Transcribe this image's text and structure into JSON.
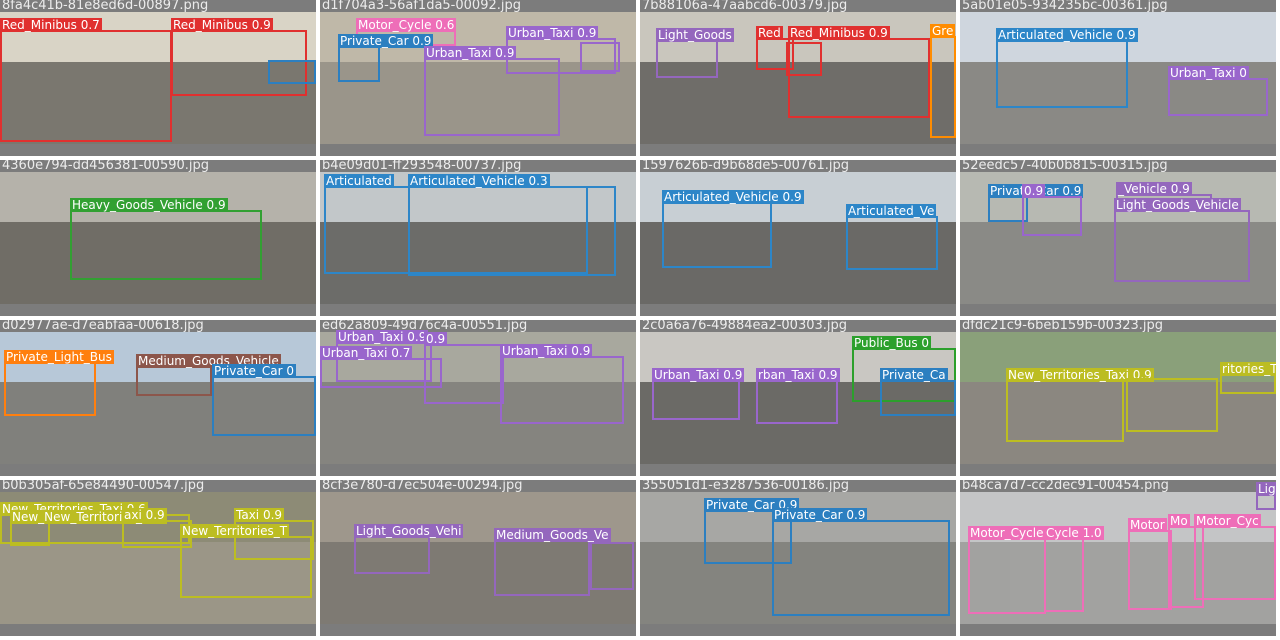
{
  "palette": {
    "Red_Minibus": "#e0302f",
    "Motor_Cycle": "#ee6eb8",
    "Private_Car": "#2c7fc0",
    "Urban_Taxi": "#9966cc",
    "Light_Goods_Vehicle": "#9467bd",
    "Green_Minibus": "#ff8c00",
    "Articulated_Vehicle": "#2d86c8",
    "Heavy_Goods_Vehicle": "#32a032",
    "Private_Light_Bus": "#ff7f0e",
    "Medium_Goods_Vehicle": "#8c564b",
    "Public_Bus": "#2ca02c",
    "New_Territories_Taxi": "#bcbd22"
  },
  "tiles": [
    {
      "filename": "8fa4c41b-81e8ed6d-00897.png",
      "sky": "#d9d4c6",
      "ground": "#7a776f",
      "detections": [
        {
          "label": "Red_Minibus 0.7",
          "cls": "Red_Minibus"
        },
        {
          "label": "Red_Minibus 0.9",
          "cls": "Red_Minibus"
        },
        {
          "label": "",
          "cls": "Private_Car"
        }
      ]
    },
    {
      "filename": "d1f704a3-56af1da5-00092.jpg",
      "sky": "#bfb8a8",
      "ground": "#9a958a",
      "detections": [
        {
          "label": "Motor_Cycle 0.6",
          "cls": "Motor_Cycle"
        },
        {
          "label": "Private_Car 0.9",
          "cls": "Private_Car"
        },
        {
          "label": "Urban_Taxi 0.9",
          "cls": "Urban_Taxi"
        },
        {
          "label": "Urban_Taxi 0.9",
          "cls": "Urban_Taxi"
        },
        {
          "label": "",
          "cls": "Urban_Taxi"
        }
      ]
    },
    {
      "filename": "7b88106a-47aabcd6-00379.jpg",
      "sky": "#c9c6bd",
      "ground": "#6f6d69",
      "detections": [
        {
          "label": "Light_Goods",
          "cls": "Light_Goods_Vehicle"
        },
        {
          "label": "Red",
          "cls": "Red_Minibus"
        },
        {
          "label": "Red_Minibus 0.9",
          "cls": "Red_Minibus"
        },
        {
          "label": "",
          "cls": "Red_Minibus"
        },
        {
          "label": "Gre",
          "cls": "Green_Minibus"
        }
      ]
    },
    {
      "filename": "5ab01e05-934235bc-00361.jpg",
      "sky": "#cfd6de",
      "ground": "#8a8985",
      "detections": [
        {
          "label": "Articulated_Vehicle 0.9",
          "cls": "Articulated_Vehicle"
        },
        {
          "label": "Urban_Taxi 0",
          "cls": "Urban_Taxi"
        }
      ]
    },
    {
      "filename": "4360e794-dd456381-00590.jpg",
      "sky": "#b5b2aa",
      "ground": "#706d66",
      "detections": [
        {
          "label": "Heavy_Goods_Vehicle 0.9",
          "cls": "Heavy_Goods_Vehicle"
        }
      ]
    },
    {
      "filename": "b4e09d01-ff293548-00737.jpg",
      "sky": "#c2c7c9",
      "ground": "#6c6c69",
      "detections": [
        {
          "label": "Articulated",
          "cls": "Articulated_Vehicle"
        },
        {
          "label": "Articulated_Vehicle 0.3",
          "cls": "Articulated_Vehicle"
        }
      ]
    },
    {
      "filename": "1597626b-d9b68de5-00761.jpg",
      "sky": "#c8cfd4",
      "ground": "#6a6966",
      "detections": [
        {
          "label": "Articulated_Vehicle 0.9",
          "cls": "Articulated_Vehicle"
        },
        {
          "label": "Articulated_Ve",
          "cls": "Articulated_Vehicle"
        }
      ]
    },
    {
      "filename": "52eedc57-40b0b815-00315.jpg",
      "sky": "#b7b9b2",
      "ground": "#8a8a86",
      "detections": [
        {
          "label": "Private_Car 0.9",
          "cls": "Private_Car"
        },
        {
          "label": "0.9",
          "cls": "Urban_Taxi"
        },
        {
          "label": "_Vehicle 0.9",
          "cls": "Light_Goods_Vehicle"
        },
        {
          "label": "Light_Goods_Vehicle",
          "cls": "Light_Goods_Vehicle"
        }
      ]
    },
    {
      "filename": "d02977ae-d7eabfaa-00618.jpg",
      "sky": "#b7c8d8",
      "ground": "#80807c",
      "detections": [
        {
          "label": "Private_Light_Bus",
          "cls": "Private_Light_Bus"
        },
        {
          "label": "Medium_Goods_Vehicle",
          "cls": "Medium_Goods_Vehicle"
        },
        {
          "label": "Private_Car 0",
          "cls": "Private_Car"
        }
      ]
    },
    {
      "filename": "ed62a809-49d76c4a-00551.jpg",
      "sky": "#a8a89e",
      "ground": "#85847f",
      "detections": [
        {
          "label": "Urban_Taxi 0.9",
          "cls": "Urban_Taxi"
        },
        {
          "label": "Urban_Taxi 0.7",
          "cls": "Urban_Taxi"
        },
        {
          "label": "0.9",
          "cls": "Urban_Taxi"
        },
        {
          "label": "Urban_Taxi 0.9",
          "cls": "Urban_Taxi"
        }
      ]
    },
    {
      "filename": "2c0a6a76-49884ea2-00303.jpg",
      "sky": "#c9c7c2",
      "ground": "#6b6a66",
      "detections": [
        {
          "label": "Public_Bus 0",
          "cls": "Public_Bus"
        },
        {
          "label": "Urban_Taxi 0.9",
          "cls": "Urban_Taxi"
        },
        {
          "label": "rban_Taxi 0.9",
          "cls": "Urban_Taxi"
        },
        {
          "label": "Private_Ca",
          "cls": "Private_Car"
        }
      ]
    },
    {
      "filename": "dfdc21c9-6beb159b-00323.jpg",
      "sky": "#8aa07a",
      "ground": "#8b8780",
      "detections": [
        {
          "label": "New_Territories_Taxi 0.9",
          "cls": "New_Territories_Taxi"
        },
        {
          "label": "ritories_Tax",
          "cls": "New_Territories_Taxi"
        },
        {
          "label": "",
          "cls": "New_Territories_Taxi"
        }
      ]
    },
    {
      "filename": "b0b305af-65e84490-00547.jpg",
      "sky": "#8d8b76",
      "ground": "#9b9687",
      "detections": [
        {
          "label": "New_Territories_Taxi 0.6",
          "cls": "New_Territories_Taxi"
        },
        {
          "label": "New_New_Territories_Taxi",
          "cls": "New_Territories_Taxi"
        },
        {
          "label": "axi 0.9",
          "cls": "New_Territories_Taxi"
        },
        {
          "label": "Taxi 0.9",
          "cls": "New_Territories_Taxi"
        },
        {
          "label": "New_Territories_T",
          "cls": "New_Territories_Taxi"
        }
      ]
    },
    {
      "filename": "8cf3e780-d7ec504e-00294.jpg",
      "sky": "#9e978c",
      "ground": "#7e7a73",
      "detections": [
        {
          "label": "Light_Goods_Vehi",
          "cls": "Light_Goods_Vehicle"
        },
        {
          "label": "Medium_Goods_Ve",
          "cls": "Light_Goods_Vehicle"
        },
        {
          "label": "",
          "cls": "Light_Goods_Vehicle"
        }
      ]
    },
    {
      "filename": "355051d1-e3287536-00186.jpg",
      "sky": "#a7a7a4",
      "ground": "#84847f",
      "detections": [
        {
          "label": "Private_Car 0.9",
          "cls": "Private_Car"
        },
        {
          "label": "Private_Car 0.9",
          "cls": "Private_Car"
        }
      ]
    },
    {
      "filename": "b48ca7d7-cc2dec91-00454.png",
      "sky": "#c4c5c6",
      "ground": "#a2a2a0",
      "detections": [
        {
          "label": "Motor_Cycle 0.9",
          "cls": "Motor_Cycle"
        },
        {
          "label": "Cycle 1.0",
          "cls": "Motor_Cycle"
        },
        {
          "label": "Motor",
          "cls": "Motor_Cycle"
        },
        {
          "label": "Mo",
          "cls": "Motor_Cycle"
        },
        {
          "label": "Motor_Cyc",
          "cls": "Motor_Cycle"
        },
        {
          "label": "Lig",
          "cls": "Light_Goods_Vehicle"
        }
      ]
    }
  ]
}
